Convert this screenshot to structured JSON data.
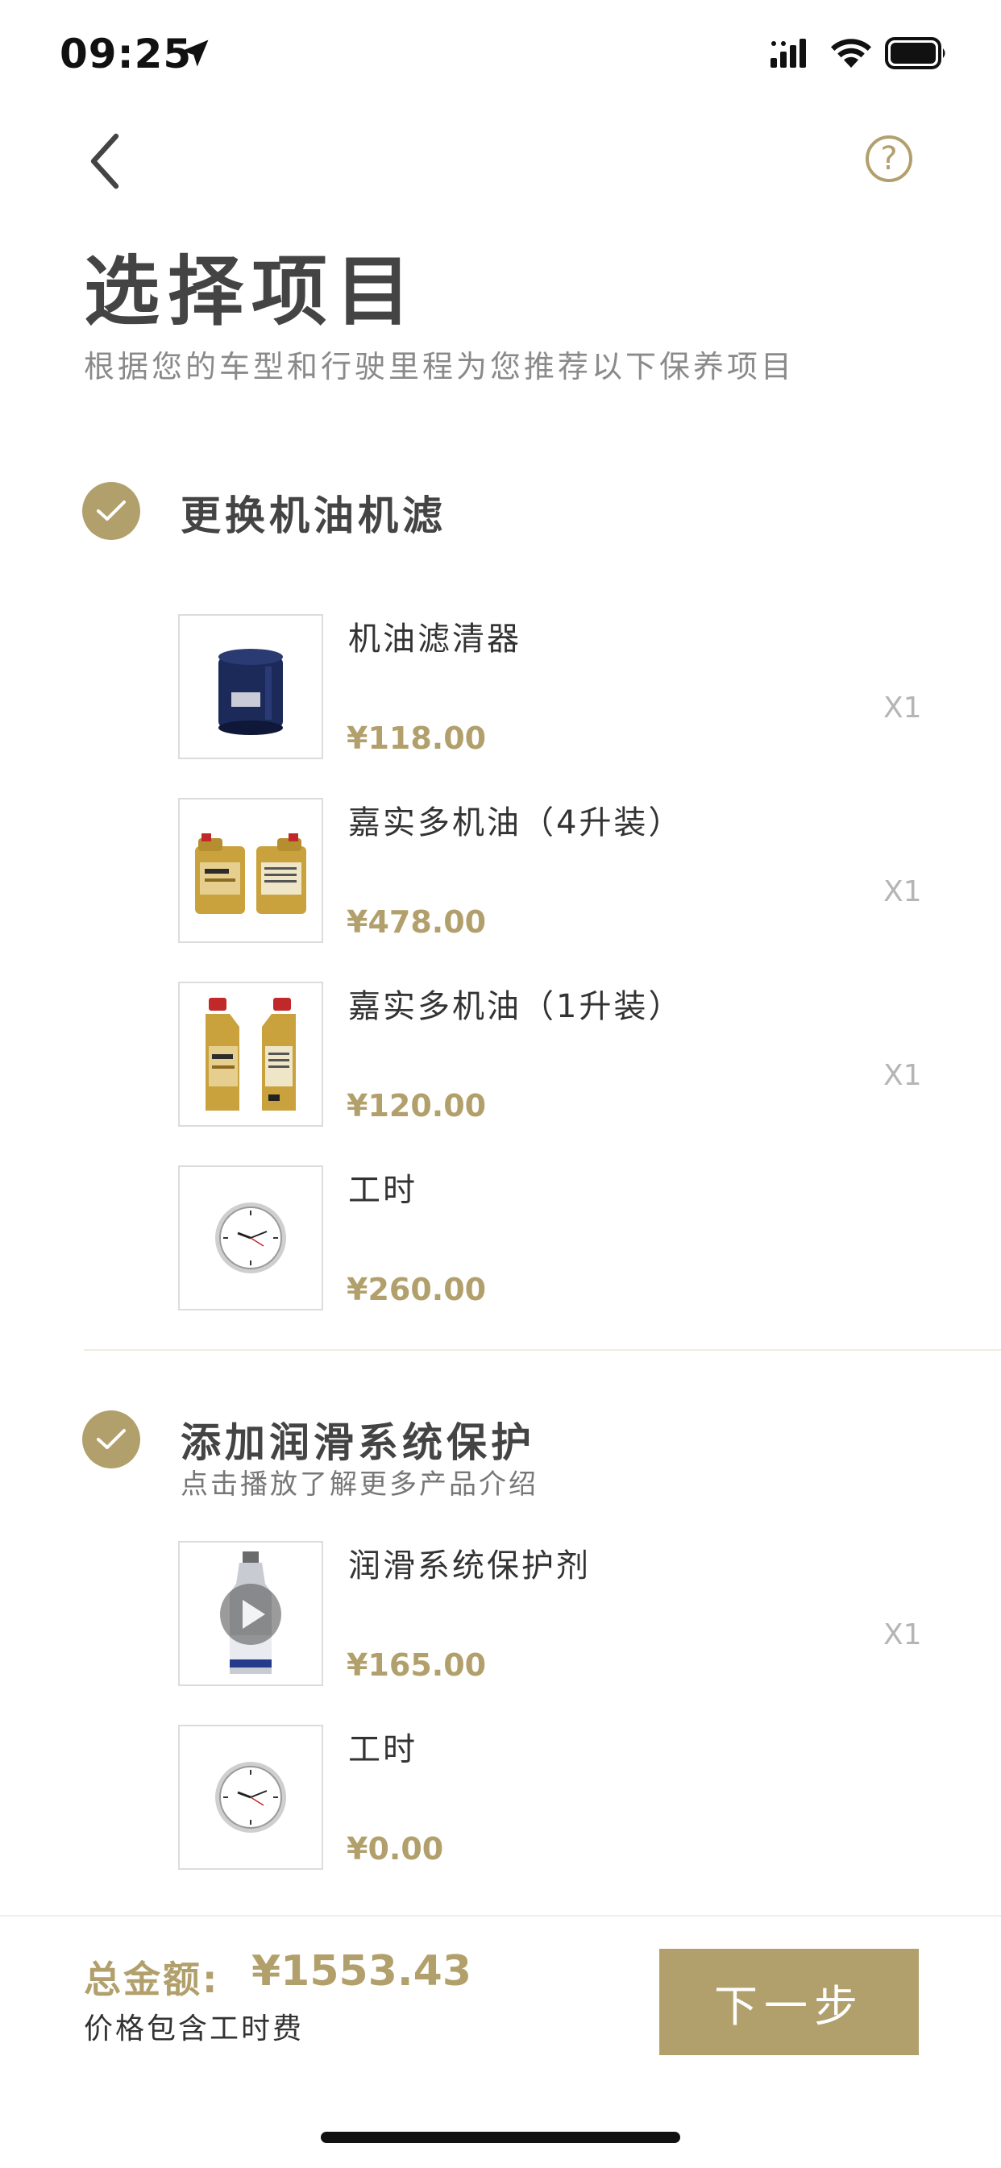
{
  "status_bar": {
    "time": "09:25"
  },
  "header": {
    "help_label": "?",
    "title": "选择项目",
    "subtitle": "根据您的车型和行驶里程为您推荐以下保养项目"
  },
  "sections": [
    {
      "title": "更换机油机滤",
      "items": [
        {
          "name": "机油滤清器",
          "price": "¥118.00",
          "qty": "X1",
          "icon": "oil-filter-image"
        },
        {
          "name": "嘉实多机油（4升装）",
          "price": "¥478.00",
          "qty": "X1",
          "icon": "engine-oil-4l-image"
        },
        {
          "name": "嘉实多机油（1升装）",
          "price": "¥120.00",
          "qty": "X1",
          "icon": "engine-oil-1l-image"
        },
        {
          "name": "工时",
          "price": "¥260.00",
          "icon": "clock-icon"
        }
      ]
    },
    {
      "title": "添加润滑系统保护",
      "subtitle": "点击播放了解更多产品介绍",
      "items": [
        {
          "name": "润滑系统保护剂",
          "price": "¥165.00",
          "qty": "X1",
          "icon": "protectant-bottle-video"
        },
        {
          "name": "工时",
          "price": "¥0.00",
          "icon": "clock-icon"
        }
      ]
    }
  ],
  "footer": {
    "total_label": "总金额:",
    "total_value": "¥1553.43",
    "total_note": "价格包含工时费",
    "next_label": "下一步"
  },
  "colors": {
    "accent": "#b2a06c",
    "text": "#333333",
    "muted": "#8a8a8a"
  }
}
